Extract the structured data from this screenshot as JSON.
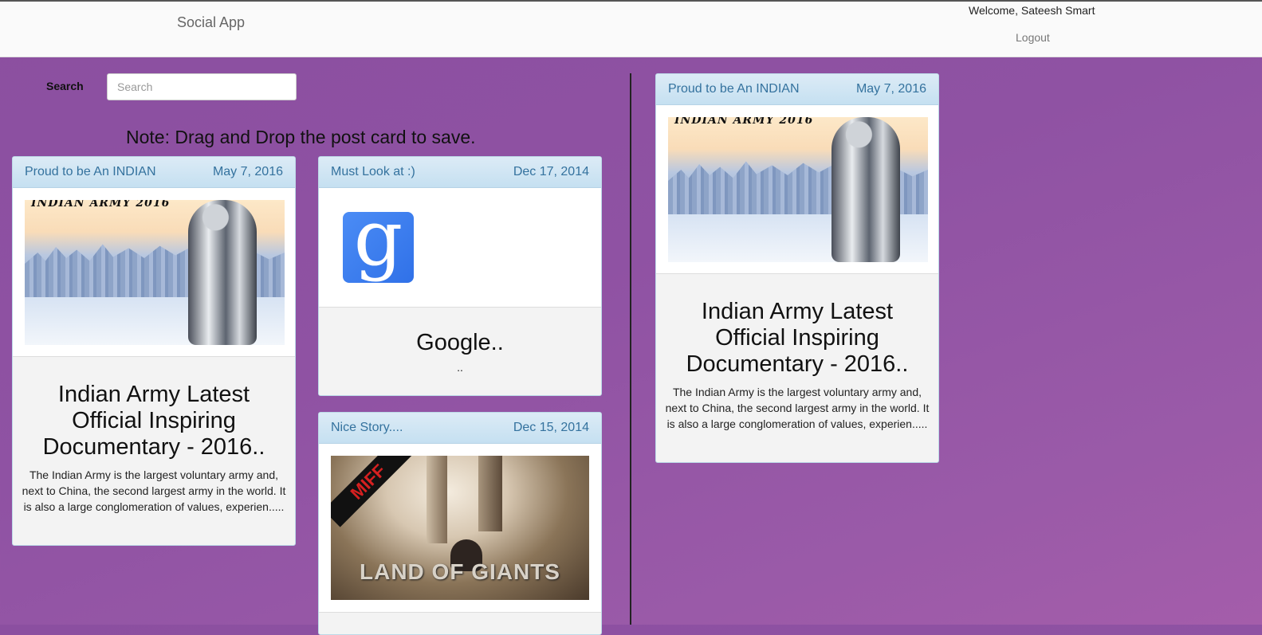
{
  "navbar": {
    "brand": "Social App",
    "welcome": "Welcome, Sateesh Smart",
    "logout": "Logout"
  },
  "search": {
    "label": "Search",
    "placeholder": "Search",
    "value": ""
  },
  "note": "Note: Drag and Drop the post card to save.",
  "left_cards": [
    {
      "header_title": "Proud to be An INDIAN",
      "date": "May 7, 2016",
      "image_caption": "INDIAN ARMY 2016",
      "title": "Indian Army Latest Official Inspiring Documentary - 2016..",
      "text": "The Indian Army is the largest voluntary army and, next to China, the second largest army in the world. It is also a large conglomeration of values, experien....."
    },
    {
      "header_title": "Must Look at :)",
      "date": "Dec 17, 2014",
      "image_icon": "google-logo",
      "image_glyph": "g",
      "title": "Google..",
      "text": ".."
    },
    {
      "header_title": "Nice Story....",
      "date": "Dec 15, 2014",
      "image_badge": "MIFF",
      "image_caption": "LAND OF GIANTS"
    }
  ],
  "saved_card": {
    "header_title": "Proud to be An INDIAN",
    "date": "May 7, 2016",
    "image_caption": "INDIAN ARMY 2016",
    "title": "Indian Army Latest Official Inspiring Documentary - 2016..",
    "text": "The Indian Army is the largest voluntary army and, next to China, the second largest army in the world. It is also a large conglomeration of values, experien....."
  }
}
